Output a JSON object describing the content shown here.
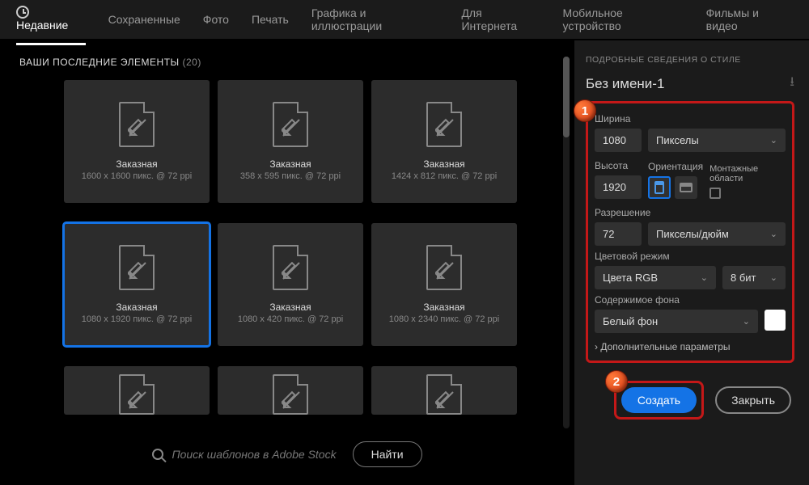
{
  "tabs": [
    {
      "label": "Недавние",
      "active": true
    },
    {
      "label": "Сохраненные"
    },
    {
      "label": "Фото"
    },
    {
      "label": "Печать"
    },
    {
      "label": "Графика и иллюстрации"
    },
    {
      "label": "Для Интернета"
    },
    {
      "label": "Мобильное устройство"
    },
    {
      "label": "Фильмы и видео"
    }
  ],
  "recent": {
    "title": "ВАШИ ПОСЛЕДНИЕ ЭЛЕМЕНТЫ",
    "count": "(20)",
    "items": [
      {
        "name": "Заказная",
        "detail": "1600 x 1600 пикс. @ 72 ppi"
      },
      {
        "name": "Заказная",
        "detail": "358 x 595 пикс. @ 72 ppi"
      },
      {
        "name": "Заказная",
        "detail": "1424 x 812 пикс. @ 72 ppi"
      },
      {
        "name": "Заказная",
        "detail": "1080 x 1920 пикс. @ 72 ppi",
        "selected": true
      },
      {
        "name": "Заказная",
        "detail": "1080 x 420 пикс. @ 72 ppi"
      },
      {
        "name": "Заказная",
        "detail": "1080 x 2340 пикс. @ 72 ppi"
      }
    ]
  },
  "search": {
    "placeholder": "Поиск шаблонов в Adobe Stock",
    "find": "Найти"
  },
  "panel": {
    "header": "ПОДРОБНЫЕ СВЕДЕНИЯ О СТИЛЕ",
    "name": "Без имени-1",
    "width_label": "Ширина",
    "width": "1080",
    "units": "Пикселы",
    "height_label": "Высота",
    "height": "1920",
    "orient_label": "Ориентация",
    "artboards_label": "Монтажные области",
    "res_label": "Разрешение",
    "res": "72",
    "res_units": "Пикселы/дюйм",
    "color_label": "Цветовой режим",
    "color": "Цвета RGB",
    "bits": "8 бит",
    "bg_label": "Содержимое фона",
    "bg": "Белый фон",
    "advanced": "Дополнительные параметры",
    "create": "Создать",
    "close": "Закрыть"
  },
  "markers": {
    "one": "1",
    "two": "2"
  }
}
